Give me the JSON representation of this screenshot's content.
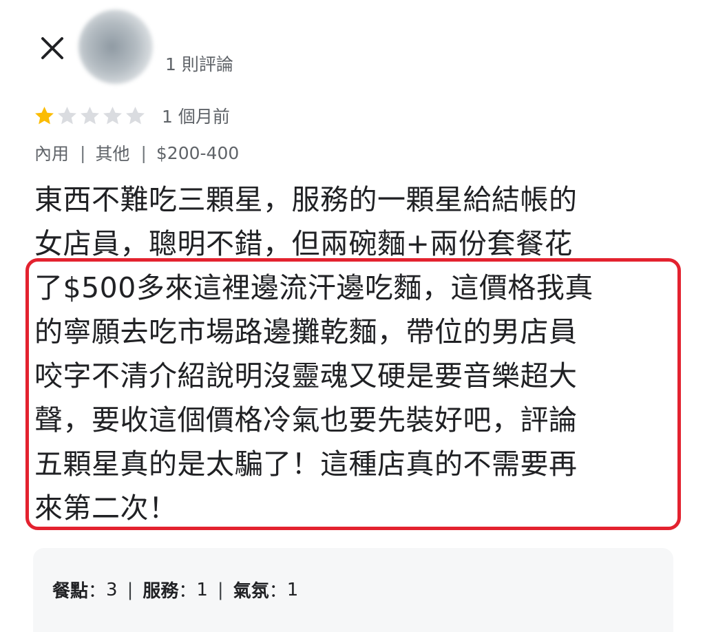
{
  "header": {
    "close_icon": "close-icon",
    "review_count": "1 則評論"
  },
  "rating": {
    "stars_filled": 1,
    "stars_total": 5,
    "star_color": "#fbbc04",
    "star_empty_color": "#dadce0",
    "time_ago": "1 個月前"
  },
  "meta": {
    "items": [
      "內用",
      "其他",
      "$200-400"
    ],
    "separator": "|"
  },
  "review": {
    "text": "東西不難吃三顆星，服務的一顆星給結帳的\n女店員，聰明不錯，但兩碗麵+兩份套餐花\n了$500多來這裡邊流汗邊吃麵，這價格我真\n的寧願去吃市場路邊攤乾麵，帶位的男店員\n咬字不清介紹說明沒靈魂又硬是要音樂超大\n聲，要收這個價格冷氣也要先裝好吧，評論\n五顆星真的是太騙了！這種店真的不需要再\n來第二次！",
    "highlight_color": "#e3222f"
  },
  "sub_ratings": {
    "items": [
      {
        "label": "餐點",
        "value": "3"
      },
      {
        "label": "服務",
        "value": "1"
      },
      {
        "label": "氣氛",
        "value": "1"
      }
    ],
    "colon": "：",
    "separator": "|"
  }
}
